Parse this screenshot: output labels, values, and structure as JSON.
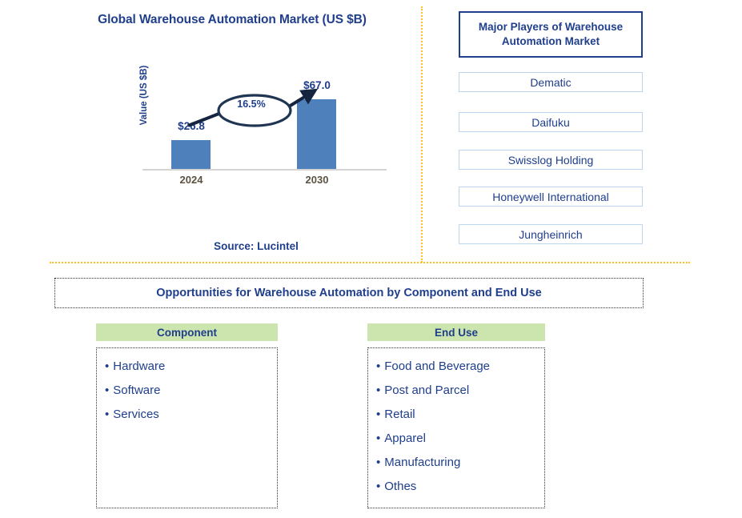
{
  "chart_panel": {
    "title": "Global Warehouse Automation Market (US $B)",
    "source": "Source: Lucintel"
  },
  "chart_data": {
    "type": "bar",
    "title": "Global Warehouse Automation Market (US $B)",
    "categories": [
      "2024",
      "2030"
    ],
    "values": [
      26.8,
      67.0
    ],
    "value_labels": [
      "$26.8",
      "$67.0"
    ],
    "xlabel": "",
    "ylabel": "Value (US $B)",
    "ylim": [
      0,
      75
    ],
    "grid": false,
    "legend": false,
    "annotations": [
      {
        "text": "16.5%",
        "kind": "cagr-callout",
        "from": "2024",
        "to": "2030"
      }
    ],
    "series_color": "#4E81BC"
  },
  "players_panel": {
    "header": "Major Players of Warehouse Automation Market",
    "items": [
      {
        "label": "Dematic"
      },
      {
        "label": "Daifuku"
      },
      {
        "label": "Swisslog Holding"
      },
      {
        "label": "Honeywell International"
      },
      {
        "label": "Jungheinrich"
      }
    ]
  },
  "opportunities": {
    "banner": "Opportunities for Warehouse Automation by Component and End Use",
    "columns": [
      {
        "header": "Component",
        "items": [
          "Hardware",
          "Software",
          "Services"
        ]
      },
      {
        "header": "End Use",
        "items": [
          "Food and Beverage",
          "Post and Parcel",
          "Retail",
          "Apparel",
          "Manufacturing",
          "Othes"
        ]
      }
    ],
    "bullet_glyph": "•"
  },
  "colors": {
    "brand_navy": "#1F3E8C",
    "bar_blue": "#4E81BC",
    "divider_orange": "#FFC222",
    "header_green": "#CCE5AE",
    "tick_brown": "#5B5242",
    "player_border": "#BBD6EE"
  }
}
